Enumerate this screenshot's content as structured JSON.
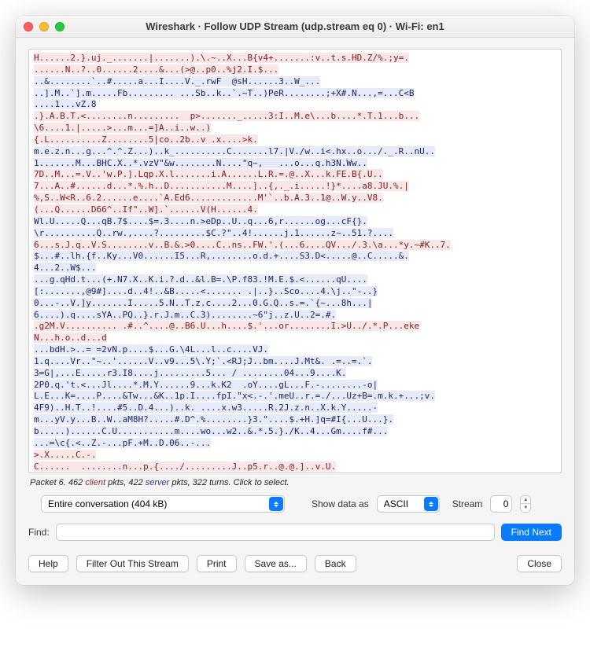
{
  "window": {
    "title": "Wireshark · Follow UDP Stream (udp.stream eq 0) · Wi-Fi: en1"
  },
  "stream": {
    "segments": [
      {
        "side": "client",
        "text": "H......2.}.uj._.......|.......).\\.~..X...B{v4+.......:v..t.s.HD.Z/%.;y=.\n......N..?..0......2....&...(>@..p0..%j2.I.$..."
      },
      {
        "side": "server",
        "text": "\n..&........`..#.....a...I....V._.rwF  @sH......3..W_...\n..].M..`].m.....Fb......... ...Sb..k..`.~T..)PeR........;+X#.N...,=...C<B\n....1...vZ.8"
      },
      {
        "side": "client",
        "text": "\n.}.A.B.T.<........n.........  p>......._.....3:I..M.e\\...b....*.T.1...b...\n\\6....1.|.....>...m...=]A..i..w..)\n{.L..........Z........5|co..2b..v .x....>k."
      },
      {
        "side": "server",
        "text": "\nm.e.z.n...g...^.^.Z...)..k_..........C.......l7.|V./w..i<.hx..o.../._.R..nU..\n1.......M...BHC.X..*.vzV\"&w........N....\"q~,   ...o...q.h3N.Ww.."
      },
      {
        "side": "client",
        "text": "\n7D..M...=.V..'w.P.].Lqp.X.l.......i.A......L.R.=.@..X...k.FE.B{.U..\n7...A..#......d...*.%.h..D...........M....]..{,._.i.....!}*....a8.JU.%.|\n%,S..W<R..6.2......e....`A.Ed6.............M'`..b.A.3..1@..W.y..V8.\n(...Q......D66^..If\"..W].`......V(H......4."
      },
      {
        "side": "server",
        "text": "\nWl.U.....Q...qB.7$....$=.3....n.>eDp..U..q...6,r......og...cF{}.\n\\r..........Q..rw.,....?.........$C.?\"..4!......j.1......z~..51.?...."
      },
      {
        "side": "client",
        "text": "\n6...s.J.q..V.S........v..B.&.>0....C..ns..FW.'.(...6....QV.../.3.\\a...*y.~#K..7."
      },
      {
        "side": "server",
        "text": "\n$...#..lh.{f..Ky...V0......I5...R,........o.d.+....S3.D<.....@..C.....&.\n4...2..W$...\n...g.qHd.t...(+.N7.X..K.i.?.d..&l.B=.\\P.f83.!M.E.$.<......qU....\n[:.......,@9#]....d..4!..&B.....<....... .|..}..Sco....4.\\j..\"-..}\n0...-..V.]y.......I.....5.N..T.z.c....2...0.G.Q..s.=.`{~...8h...|\n6....).q....sYA..PQ..}.r.J.m..C.3)........~6\"j..z.U..2=.#."
      },
      {
        "side": "client",
        "text": "\n.g2M.V.......... .#..^....@..B6.U...h....$.'...or........I.>U../.*.P...eke\nN...h.o..d...d"
      },
      {
        "side": "server",
        "text": "\n...bdH.>..= =2vN.p....$...G.\\4L...l..c....VJ.\n1.q....Vr..\"~..'......V..v9...5\\.Y;`.<RJ;J..bm....J.Mt&. .=..=.`.\n3=G|,...E.....r3.I8....j.........5... / ........04...9....K.\n2P0.q.'t.<...Jl....*.M.Y......9...k.K2  .oY....gL...F.-........-o|\nL.E...K=....P....&Tw...&K..1p.I....fpI.\"x<.-.'.meU..r.=./...Uz+B=.m.k.+...;v.\n4F9)..H.T..!....#5..D.4...)..k. ....x.w3.....R.2J.z.n..X.k.Y.....-\nm...yV.y...B..W..aM8H?.....#.D^.%........}3.\"....$.+H.]q=#I{...U...}.\nb.....)......C.U...........m....wo...w2..&.*.5.}./K..4...Gm....f#...\n...=\\c{.<..Z.-...pF.+M..D.06..-..."
      },
      {
        "side": "client",
        "text": "\n>.X.....C.-.\nC......  ........n...p.{..../.........J..p5.r..@.@.]..v.U.\n"
      }
    ]
  },
  "status": {
    "packet_prefix": "Packet 6. 462 ",
    "client_word": "client",
    "mid1": " pkts, 422 ",
    "server_word": "server",
    "suffix": " pkts, 322 turns. Click to select."
  },
  "controls": {
    "conversation_select": "Entire conversation (404 kB)",
    "show_data_label": "Show data as",
    "data_format": "ASCII",
    "stream_label": "Stream",
    "stream_value": "0"
  },
  "find": {
    "label": "Find:",
    "value": "",
    "button": "Find Next"
  },
  "buttons": {
    "help": "Help",
    "filter_out": "Filter Out This Stream",
    "print": "Print",
    "save_as": "Save as...",
    "back": "Back",
    "close": "Close"
  },
  "colors": {
    "client_fg": "#7a1b1b",
    "client_bg": "#f9e7e7",
    "server_fg": "#17245f",
    "server_bg": "#e6eaf9",
    "accent": "#0a7bfd"
  }
}
